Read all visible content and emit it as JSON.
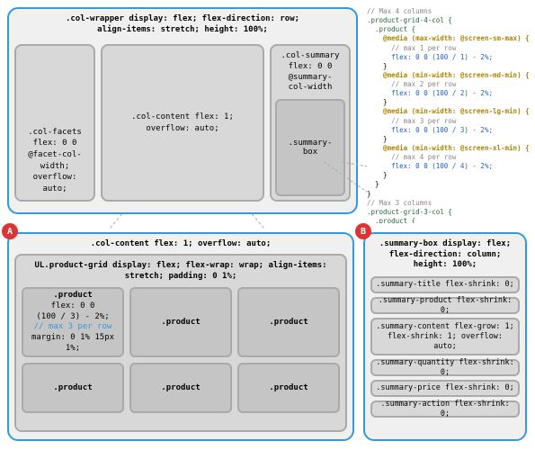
{
  "top": {
    "wrapper_label": ".col-wrapper display: flex; flex-direction: row;\nalign-items: stretch; height: 100%;",
    "facets": ".col-facets\nflex: 0 0\n@facet-col-\nwidth;\noverflow:\nauto;",
    "content": ".col-content flex: 1;\noverflow: auto;",
    "summary_label": ".col-summary\nflex: 0 0\n@summary-\ncol-width",
    "summary_box": ".summary-\nbox"
  },
  "badges": {
    "a": "A",
    "b": "B"
  },
  "bl": {
    "header": ".col-content flex: 1; overflow: auto;",
    "grid_label": "UL.product-grid display: flex; flex-wrap: wrap; align-items:\nstretch; padding: 0 1%;",
    "product_main_name": ".product",
    "product_main_rules": "flex: 0 0\n(100 / 3) - 2%;",
    "product_main_comment": "// max 3 per row",
    "product_main_margin": "margin: 0 1% 15px\n1%;",
    "product_plain": ".product"
  },
  "br": {
    "header": ".summary-box display: flex;\nflex-direction: column; height: 100%;",
    "items": [
      ".summary-title flex-shrink: 0;",
      ".summary-product flex-shrink: 0;",
      ".summary-content flex-grow: 1;\nflex-shrink: 1; overflow: auto;",
      ".summary-quantity flex-shrink: 0;",
      ".summary-price flex-shrink: 0;",
      ".summary-action flex-shrink: 0;"
    ]
  },
  "code": {
    "c1": "// Max 4 columns",
    "sel_4": ".product-grid-4-col {",
    "sel_prod": "  .product {",
    "media1": "    @media (max-width: @screen-sm-max) {",
    "mc1": "      // max 1 per row",
    "flex1": "      flex: 0 0 (100 / 1) - 2%;",
    "media2": "    @media (min-width: @screen-md-min) {",
    "mc2": "      // max 2 per row",
    "flex2": "      flex: 0 0 (100 / 2) - 2%;",
    "media3": "    @media (min-width: @screen-lg-min) {",
    "mc3": "      // max 3 per row",
    "flex3": "      flex: 0 0 (100 / 3) - 2%;",
    "media4": "    @media (min-width: @screen-xl-min) {",
    "mc4": "      // max 4 per row",
    "flex4": "      flex: 0 0 (100 / 4) - 2%;",
    "close": "    }",
    "close2": "  }",
    "close3": "}",
    "c2": "// Max 3 columns",
    "sel_3": ".product-grid-3-col {"
  }
}
